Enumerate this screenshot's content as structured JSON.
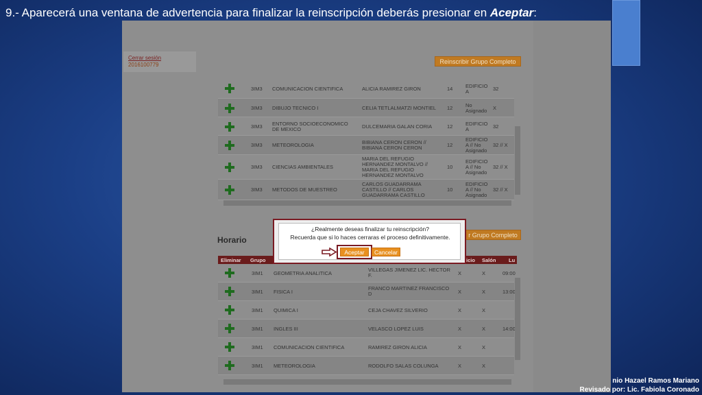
{
  "slide": {
    "instruction_prefix": "9.- Aparecerá una ventana de advertencia para finalizar la reinscripción deberás presionar en ",
    "instruction_bold": "Aceptar",
    "instruction_suffix": ":",
    "credits_line1": "nio Hazael Ramos Mariano",
    "credits_line2": "Revisado por: Lic. Fabiola Coronado Luna",
    "accent_color": "#c8102e"
  },
  "user": {
    "logout_label": "Cerrar sesión",
    "student_id": "2016100779"
  },
  "buttons": {
    "reenroll_all_top": "Reinscribir Grupo Completo",
    "reenroll_all_bottom": "r Grupo Completo"
  },
  "available_groups": [
    {
      "group": "3IM3",
      "subject": "COMUNICACION CIENTIFICA",
      "teacher": "ALICIA RAMIREZ GIRON",
      "credits": "14",
      "building": "EDIFICIO A",
      "slots": "32"
    },
    {
      "group": "3IM3",
      "subject": "DIBUJO TECNICO I",
      "teacher": "CELIA TETLALMATZI MONTIEL",
      "credits": "12",
      "building": "No Asignado",
      "slots": "X"
    },
    {
      "group": "3IM3",
      "subject": "ENTORNO SOCIOECONOMICO DE MEXICO",
      "teacher": "DULCEMARIA GALAN CORIA",
      "credits": "12",
      "building": "EDIFICIO A",
      "slots": "32"
    },
    {
      "group": "3IM3",
      "subject": "METEOROLOGIA",
      "teacher": "BIBIANA CERON CERON // BIBIANA CERON CERON",
      "credits": "12",
      "building": "EDIFICIO A // No Asignado",
      "slots": "32 // X"
    },
    {
      "group": "3IM3",
      "subject": "CIENCIAS AMBIENTALES",
      "teacher": "MARIA DEL REFUGIO HERNANDEZ MONTALVO // MARIA DEL REFUGIO HERNANDEZ MONTALVO",
      "credits": "10",
      "building": "EDIFICIO A // No Asignado",
      "slots": "32 // X"
    },
    {
      "group": "3IM3",
      "subject": "METODOS DE MUESTREO",
      "teacher": "CARLOS GUADARRAMA CASTILLO // CARLOS GUADARRAMA CASTILLO",
      "credits": "10",
      "building": "EDIFICIO A // No Asignado",
      "slots": "32 // X"
    }
  ],
  "schedule": {
    "title": "Horario",
    "headers": {
      "remove": "Eliminar",
      "group": "Grupo",
      "start": "icio",
      "room": "Salón",
      "time": "Lu"
    },
    "rows": [
      {
        "group": "3IM1",
        "subject": "GEOMETRIA ANALITICA",
        "teacher": "VILLEGAS JIMENEZ LIC. HECTOR F.",
        "c1": "X",
        "c2": "X",
        "time": "09:00"
      },
      {
        "group": "3IM1",
        "subject": "FISICA I",
        "teacher": "FRANCO MARTINEZ FRANCISCO D",
        "c1": "X",
        "c2": "X",
        "time": "13:00"
      },
      {
        "group": "3IM1",
        "subject": "QUIMICA I",
        "teacher": "CEJA CHAVEZ SILVERIO",
        "c1": "X",
        "c2": "X",
        "time": ""
      },
      {
        "group": "3IM1",
        "subject": "INGLES III",
        "teacher": "VELASCO LOPEZ LUIS",
        "c1": "X",
        "c2": "X",
        "time": "14:00"
      },
      {
        "group": "3IM1",
        "subject": "COMUNICACION CIENTIFICA",
        "teacher": "RAMIREZ GIRON ALICIA",
        "c1": "X",
        "c2": "X",
        "time": ""
      },
      {
        "group": "3IM1",
        "subject": "METEOROLOGIA",
        "teacher": "RODOLFO SALAS COLUNGA",
        "c1": "X",
        "c2": "X",
        "time": ""
      }
    ]
  },
  "dialog": {
    "line1": "¿Realmente deseas finalizar tu reinscripción?",
    "line2": "Recuerda que si lo haces cerraras el proceso definitivamente.",
    "accept_label": "Aceptar",
    "cancel_label": "Cancelar",
    "arrow_icon": "arrow-right-icon"
  }
}
